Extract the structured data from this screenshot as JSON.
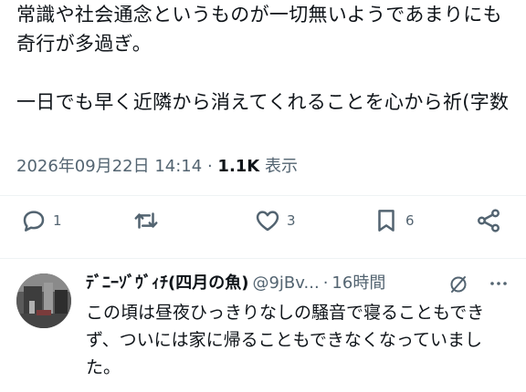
{
  "tweet": {
    "text": "常識や社会通念というものが一切無いようであまりにも奇行が多過ぎ。\n\n一日でも早く近隣から消えてくれることを心から祈(字数",
    "datetime": "2026年09月22日 14:14",
    "separator": "·",
    "views_count": "1.1K",
    "views_label": "表示"
  },
  "actions": {
    "reply_count": "1",
    "retweet_count": "",
    "like_count": "3",
    "bookmark_count": "6"
  },
  "icons": {
    "reply": "reply-icon",
    "retweet": "retweet-icon",
    "like": "heart-icon",
    "bookmark": "bookmark-icon",
    "share": "share-icon",
    "grok": "grok-icon",
    "more": "more-icon"
  },
  "reply": {
    "name": "ﾃﾞﾆｰｿﾞｳﾞｨﾁ(四月の魚)",
    "handle": "@9jBv...",
    "separator": "·",
    "time": "16時間",
    "text": "この頃は昼夜ひっきりなしの騒音で寝ることもできず、ついには家に帰ることもできなくなっていました。"
  },
  "colors": {
    "text": "#0f1419",
    "secondary": "#536471",
    "divider": "#eff3f4"
  }
}
